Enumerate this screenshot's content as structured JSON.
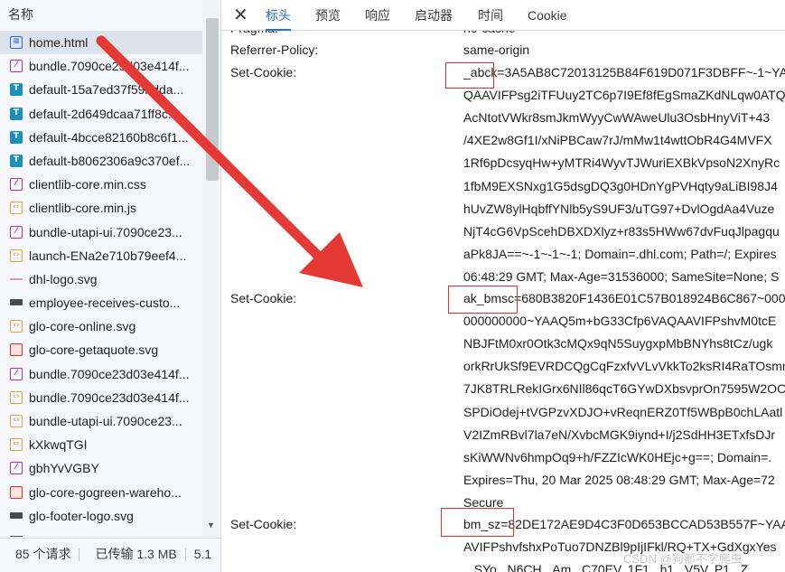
{
  "left_panel": {
    "header": "名称",
    "items": [
      {
        "name": "home.html",
        "icon": "doc-icon",
        "glyph": "≡",
        "kind": "doc"
      },
      {
        "name": "bundle.7090ce23d03e414f...",
        "icon": "stylesheet-icon",
        "glyph": "⁄",
        "kind": "css"
      },
      {
        "name": "default-15a7ed37f59bdda...",
        "icon": "font-icon",
        "glyph": "T",
        "kind": "font"
      },
      {
        "name": "default-2d649dcaa71ff8c...",
        "icon": "font-icon",
        "glyph": "T",
        "kind": "font"
      },
      {
        "name": "default-4bcce82160b8c6f1...",
        "icon": "font-icon",
        "glyph": "T",
        "kind": "font"
      },
      {
        "name": "default-b8062306a9c370ef...",
        "icon": "font-icon",
        "glyph": "T",
        "kind": "font"
      },
      {
        "name": "clientlib-core.min.css",
        "icon": "stylesheet-icon",
        "glyph": "⁄",
        "kind": "css"
      },
      {
        "name": "clientlib-core.min.js",
        "icon": "script-icon",
        "glyph": "‹›",
        "kind": "js"
      },
      {
        "name": "bundle-utapi-ui.7090ce23...",
        "icon": "stylesheet-icon",
        "glyph": "⁄",
        "kind": "css"
      },
      {
        "name": "launch-ENa2e710b79eef4...",
        "icon": "script-icon",
        "glyph": "‹›",
        "kind": "js"
      },
      {
        "name": "dhl-logo.svg",
        "icon": "image-dash-icon",
        "glyph": "",
        "kind": "dash"
      },
      {
        "name": "employee-receives-custo...",
        "icon": "image-icon",
        "glyph": "",
        "kind": "pic"
      },
      {
        "name": "glo-core-online.svg",
        "icon": "script-icon",
        "glyph": "‹›",
        "kind": "js"
      },
      {
        "name": "glo-core-getaquote.svg",
        "icon": "svg-red-icon",
        "glyph": "",
        "kind": "svgred"
      },
      {
        "name": "bundle.7090ce23d03e414f...",
        "icon": "stylesheet-icon",
        "glyph": "⁄",
        "kind": "css"
      },
      {
        "name": "bundle.7090ce23d03e414f...",
        "icon": "script-icon",
        "glyph": "‹›",
        "kind": "js"
      },
      {
        "name": "bundle-utapi-ui.7090ce23...",
        "icon": "script-icon",
        "glyph": "‹›",
        "kind": "js"
      },
      {
        "name": "kXkwqTGI",
        "icon": "script-icon",
        "glyph": "‹›",
        "kind": "js"
      },
      {
        "name": "gbhYvVGBY",
        "icon": "stylesheet-icon",
        "glyph": "⁄",
        "kind": "css"
      },
      {
        "name": "glo-core-gogreen-wareho...",
        "icon": "svg-red-icon",
        "glyph": "",
        "kind": "svgred"
      },
      {
        "name": "glo-footer-logo.svg",
        "icon": "image-icon",
        "glyph": "",
        "kind": "pic"
      },
      {
        "name": "...",
        "icon": "image-icon",
        "glyph": "",
        "kind": "pic"
      }
    ],
    "footer": {
      "requests": "85 个请求",
      "transferred": "已传输 1.3 MB",
      "more": "5.1"
    }
  },
  "tabs": {
    "close": "✕",
    "items": [
      "标头",
      "预览",
      "响应",
      "启动器",
      "时间",
      "Cookie"
    ],
    "active": "标头"
  },
  "headers": [
    {
      "key": "Pragma:",
      "lines": [
        "no-cache"
      ]
    },
    {
      "key": "Referrer-Policy:",
      "lines": [
        "same-origin"
      ]
    },
    {
      "key": "Set-Cookie:",
      "lines": [
        "_abck=3A5AB8C72013125B84F619D071F3DBFF~-1~YAAQ5m+bG",
        "QAAVIFPsg2iTFUuy2TC6p7I9Ef8fEgSmaZKdNLqw0ATQ",
        "AcNtotVWkr8smJkmWyyCwWAweUlu3OsbHnyViT+43",
        "/4XE2w8Gf1I/xNiPBCaw7rJ/mMw1t4wttObR4G4MVFX",
        "1Rf6pDcsyqHw+yMTRi4WyvTJWuriEXBkVpsoN2XnyRc",
        "1fbM9EXSNxg1G5dsgDQ3g0HDnYgPVHqty9aLiBI98J4",
        "hUvZW8ylHqbffYNlb5yS9UF3/uTG97+DvlOgdAa4Vuze",
        "NjT4cG6VpScehDBXDXlyz+r83s5HWw67dvFuqJlpagqu",
        "aPk8JA==~-1~-1~-1; Domain=.dhl.com; Path=/; Expires",
        "06:48:29 GMT; Max-Age=31536000; SameSite=None; S"
      ]
    },
    {
      "key": "Set-Cookie:",
      "lines": [
        "ak_bmsc=680B3820F1436E01C57B018924B6C867~000000",
        "000000000~YAAQ5m+bG33Cfp6VAQAAVIFPshvM0tcE",
        "NBJFtM0xr0Otk3cMQx9qN5SuygxpMbBNYhs8tCz/ugk",
        "orkRrUkSf9EVRDCQgCqFzxfvVLvVkkTo2ksRI4RaTOsmr",
        "7JK8TRLRekIGrx6NIl86qcT6GYwDXbsvprOn7595W2OC",
        "SPDiOdej+tVGPzvXDJO+vReqnERZ0Tf5WBpB0chLAatl",
        "V2IZmRBvl7la7eN/XvbcMGK9iynd+I/j2SdHH3ETxfsDJr",
        "sKiWWNv6hmpOq9+h/FZZIcWK0HEjc+g==; Domain=.",
        "Expires=Thu, 20 Mar 2025 08:48:29 GMT; Max-Age=72",
        "Secure"
      ]
    },
    {
      "key": "Set-Cookie:",
      "lines": [
        "bm_sz=82DE172AE9D4C3F0D653BCCAD53B557F~YAAQ5m",
        "AVIFPshvfshxPoTuo7DNZBl9pIjIFkl/RQ+TX+GdXgxYes",
        "...SYo...N6CH...Am...C70EV..1F1...h1...V5V..P1...Z..."
      ]
    }
  ],
  "watermark": "CSDN @狗都不学爬虫_",
  "colors": {
    "accent": "#1a73e8",
    "annotation": "#e03131"
  }
}
